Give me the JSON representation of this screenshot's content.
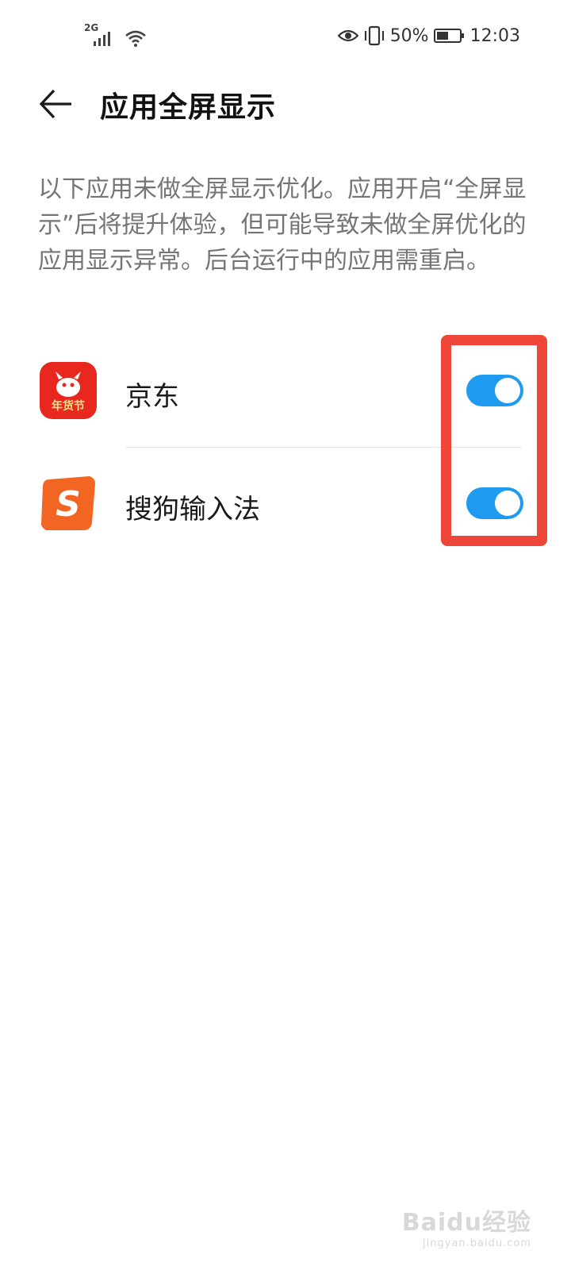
{
  "status_bar": {
    "network": "2G",
    "battery_percent": "50%",
    "time": "12:03",
    "icons": [
      "signal-icon",
      "wifi-icon",
      "eye-icon",
      "vibrate-icon",
      "battery-icon"
    ]
  },
  "header": {
    "title": "应用全屏显示",
    "back_icon": "arrow-left-icon"
  },
  "description": "以下应用未做全屏显示优化。应用开启“全屏显示”后将提升体验，但可能导致未做全屏优化的应用显示异常。后台运行中的应用需重启。",
  "apps": [
    {
      "name": "京东",
      "icon": "jd-app-icon",
      "fullscreen_enabled": true,
      "icon_caption": "年货节"
    },
    {
      "name": "搜狗输入法",
      "icon": "sogou-app-icon",
      "fullscreen_enabled": true,
      "icon_caption": "S"
    }
  ],
  "watermark": {
    "main": "Baidu经验",
    "sub": "jingyan.baidu.com"
  },
  "colors": {
    "toggle_on": "#1e9bf0",
    "highlight": "#ee4739",
    "description_text": "#757575"
  }
}
